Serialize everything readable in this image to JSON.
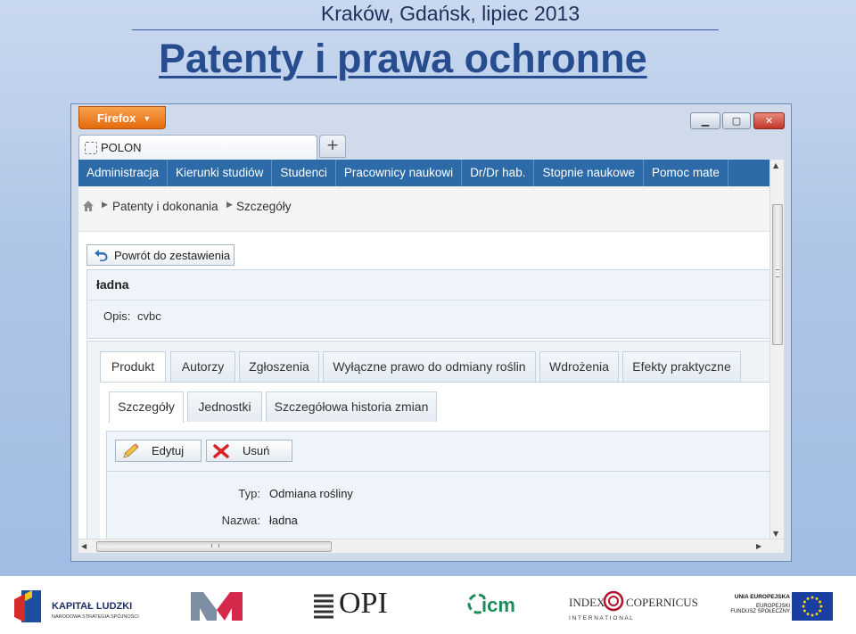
{
  "slide": {
    "subtitle": "Kraków, Gdańsk, lipiec 2013",
    "title": "Patenty i prawa ochronne"
  },
  "browser": {
    "firefox_label": "Firefox",
    "tab_title": "POLON",
    "new_tab_label": "+"
  },
  "nav": {
    "items": [
      "Administracja",
      "Kierunki studiów",
      "Studenci",
      "Pracownicy naukowi",
      "Dr/Dr hab.",
      "Stopnie naukowe",
      "Pomoc mate"
    ]
  },
  "breadcrumb": {
    "items": [
      "Patenty i dokonania",
      "Szczegóły"
    ]
  },
  "record": {
    "back_label": "Powrót do zestawienia",
    "title": "ładna",
    "desc_label": "Opis:",
    "desc_value": "cvbc"
  },
  "tabs": [
    "Produkt",
    "Autorzy",
    "Zgłoszenia",
    "Wyłączne prawo do odmiany roślin",
    "Wdrożenia",
    "Efekty praktyczne"
  ],
  "active_tab": "Produkt",
  "subtabs": [
    "Szczegóły",
    "Jednostki",
    "Szczegółowa historia zmian"
  ],
  "active_subtab": "Szczegóły",
  "toolbar": {
    "edit_label": "Edytuj",
    "delete_label": "Usuń"
  },
  "fields": [
    {
      "label": "Typ:",
      "value": "Odmiana rośliny"
    },
    {
      "label": "Nazwa:",
      "value": "ładna"
    }
  ],
  "footer": {
    "kapital_title": "KAPITAŁ LUDZKI",
    "kapital_sub": "NARODOWA STRATEGIA SPÓJNOŚCI",
    "opi": "OPI",
    "icm": "icm",
    "index_copernicus_1": "INDEX",
    "index_copernicus_2": "COPERNICUS",
    "index_copernicus_3": "I N T E R N A T I O N A L",
    "eu_1": "UNIA EUROPEJSKA",
    "eu_2": "EUROPEJSKI",
    "eu_3": "FUNDUSZ SPOŁECZNY"
  },
  "colors": {
    "nav_bg": "#2d6aa8",
    "firefox_orange": "#e46a0d",
    "title_blue": "#274d8f"
  }
}
